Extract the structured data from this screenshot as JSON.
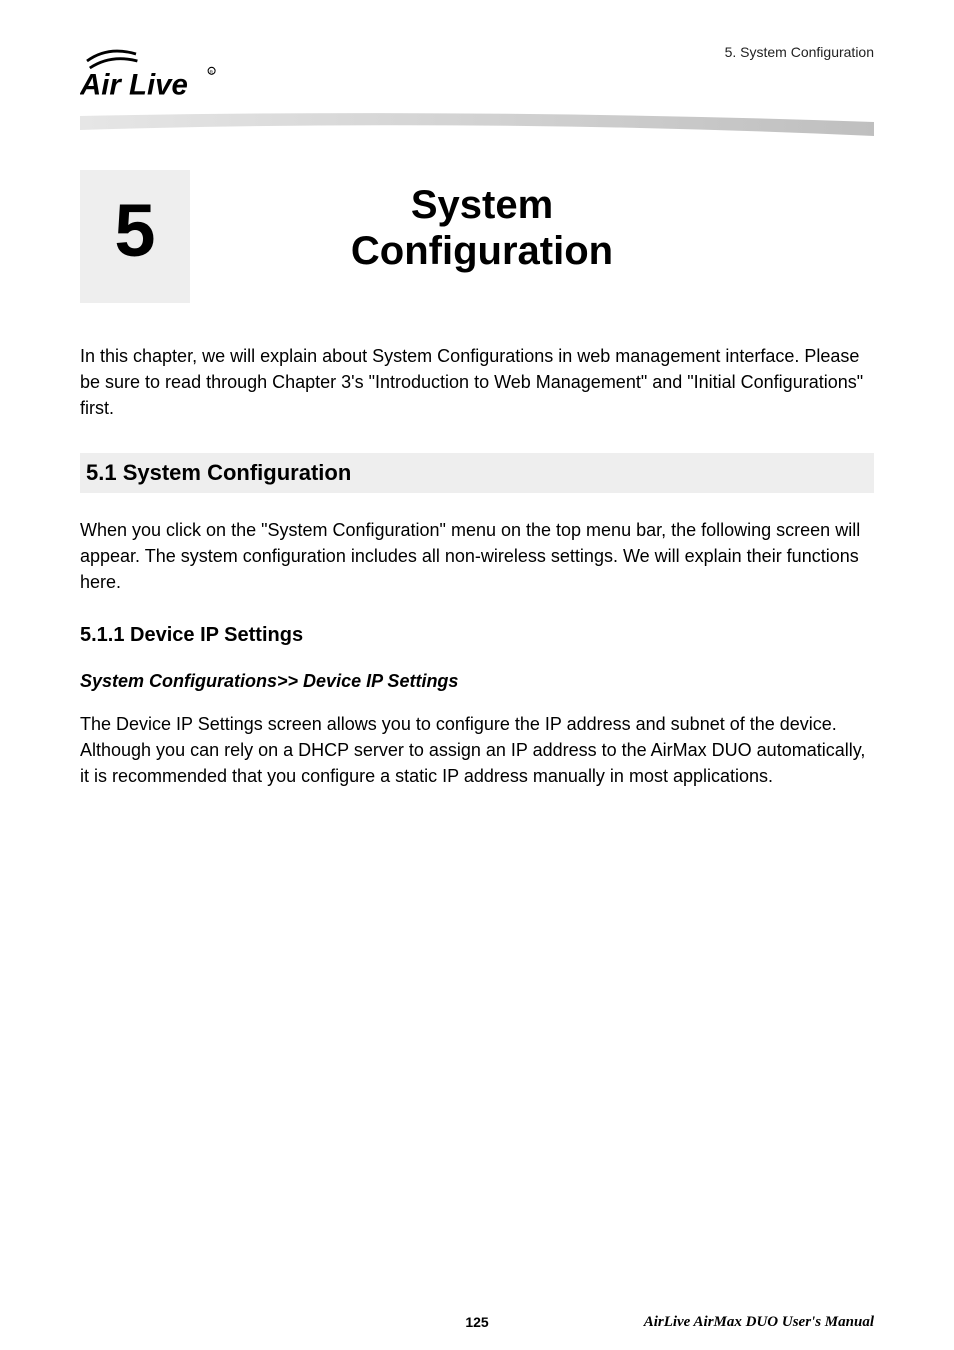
{
  "header": {
    "section_label": "5. System  Configuration",
    "logo_alt": "Air Live"
  },
  "chapter": {
    "number": "5",
    "title_line1": "System",
    "title_line2": "Configuration"
  },
  "intro_paragraph": "In this chapter, we will explain about System Configurations in web management interface. Please be sure to read through Chapter 3's \"Introduction to Web Management\" and \"Initial Configurations\" first.",
  "section": {
    "heading": "5.1 System Configuration",
    "paragraph": "When you click on the \"System Configuration\" menu on the top menu bar, the following screen will appear. The system configuration includes all non-wireless settings. We will explain their functions here."
  },
  "subsection": {
    "heading": "5.1.1 Device IP Settings",
    "breadcrumb": "System Configurations>> Device IP Settings",
    "paragraph": "The Device IP Settings screen allows you to configure the IP address and subnet of the device. Although you can rely on a DHCP server to assign an IP address to the AirMax DUO automatically, it is recommended that you configure a static IP address manually in most applications."
  },
  "footer": {
    "page_number": "125",
    "doc_title": "AirLive  AirMax  DUO  User's  Manual"
  }
}
